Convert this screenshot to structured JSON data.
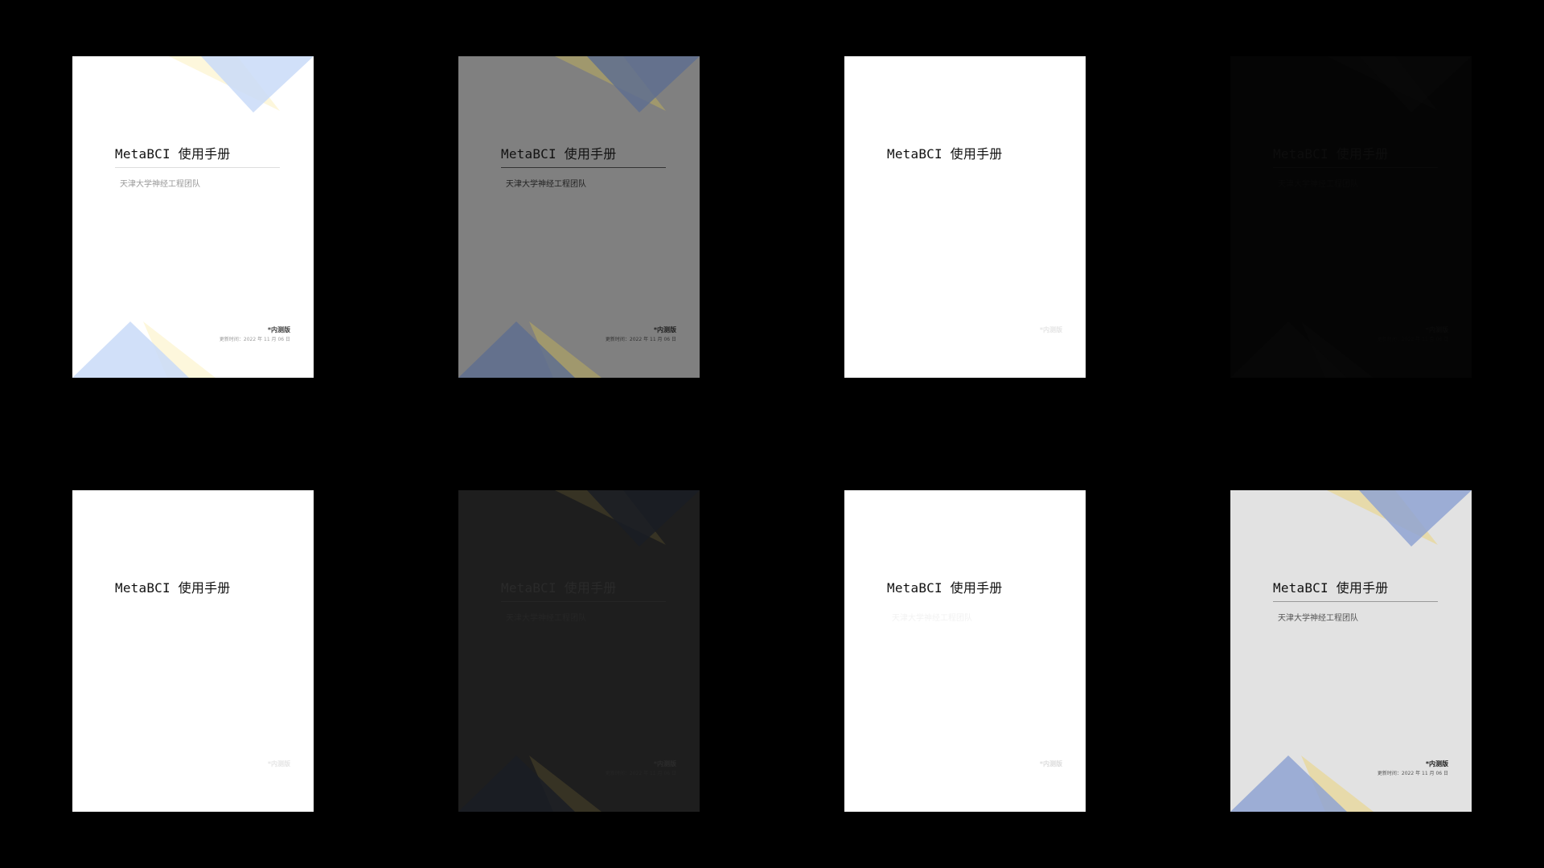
{
  "cover": {
    "title": "MetaBCI 使用手册",
    "team": "天津大学神经工程团队",
    "edition": "*内测版",
    "updated": "更新时间：2022 年 11 月 06 日"
  },
  "variants": [
    {
      "bg": "#ffffff",
      "title_color": "#111111",
      "rule_color": "#dddddd",
      "team_color": "#999999",
      "edition_color": "#444444",
      "date_color": "#999999",
      "blue": "#c9daf8",
      "yellow": "#fdf6d8",
      "show_decor": true,
      "show_team": true,
      "show_footer": true
    },
    {
      "bg": "#808080",
      "title_color": "#111111",
      "rule_color": "#333333",
      "team_color": "#222222",
      "edition_color": "#222222",
      "date_color": "#333333",
      "blue": "#5f6e8f",
      "yellow": "#a39a6a",
      "show_decor": true,
      "show_team": true,
      "show_footer": true
    },
    {
      "bg": "#ffffff",
      "title_color": "#111111",
      "rule_color": "#ffffff",
      "team_color": "#ffffff",
      "edition_color": "#e6e6e6",
      "date_color": "#ffffff",
      "blue": "#ffffff",
      "yellow": "#ffffff",
      "show_decor": false,
      "show_team": false,
      "show_footer": true
    },
    {
      "bg": "#050505",
      "title_color": "#0d0d0d",
      "rule_color": "#0a0a0a",
      "team_color": "#0a0a0a",
      "edition_color": "#0b0b0b",
      "date_color": "#0a0a0a",
      "blue": "#080808",
      "yellow": "#080808",
      "show_decor": true,
      "show_team": true,
      "show_footer": true
    },
    {
      "bg": "#ffffff",
      "title_color": "#111111",
      "rule_color": "#ffffff",
      "team_color": "#ffffff",
      "edition_color": "#e6e6e6",
      "date_color": "#ffffff",
      "blue": "#ffffff",
      "yellow": "#ffffff",
      "show_decor": false,
      "show_team": false,
      "show_footer": true
    },
    {
      "bg": "#1e1e1e",
      "title_color": "#2a2a2a",
      "rule_color": "#262626",
      "team_color": "#262626",
      "edition_color": "#2c2c2c",
      "date_color": "#262626",
      "blue": "#1a1d24",
      "yellow": "#3a3525",
      "show_decor": true,
      "show_team": true,
      "show_footer": true
    },
    {
      "bg": "#ffffff",
      "title_color": "#111111",
      "rule_color": "#ffffff",
      "team_color": "#f2f2f2",
      "edition_color": "#dddddd",
      "date_color": "#ffffff",
      "blue": "#ffffff",
      "yellow": "#ffffff",
      "show_decor": false,
      "show_team": true,
      "show_footer": true
    },
    {
      "bg": "#e2e2e2",
      "title_color": "#111111",
      "rule_color": "#999999",
      "team_color": "#555555",
      "edition_color": "#222222",
      "date_color": "#555555",
      "blue": "#8fa3d2",
      "yellow": "#e8d9a4",
      "show_decor": true,
      "show_team": true,
      "show_footer": true
    }
  ]
}
